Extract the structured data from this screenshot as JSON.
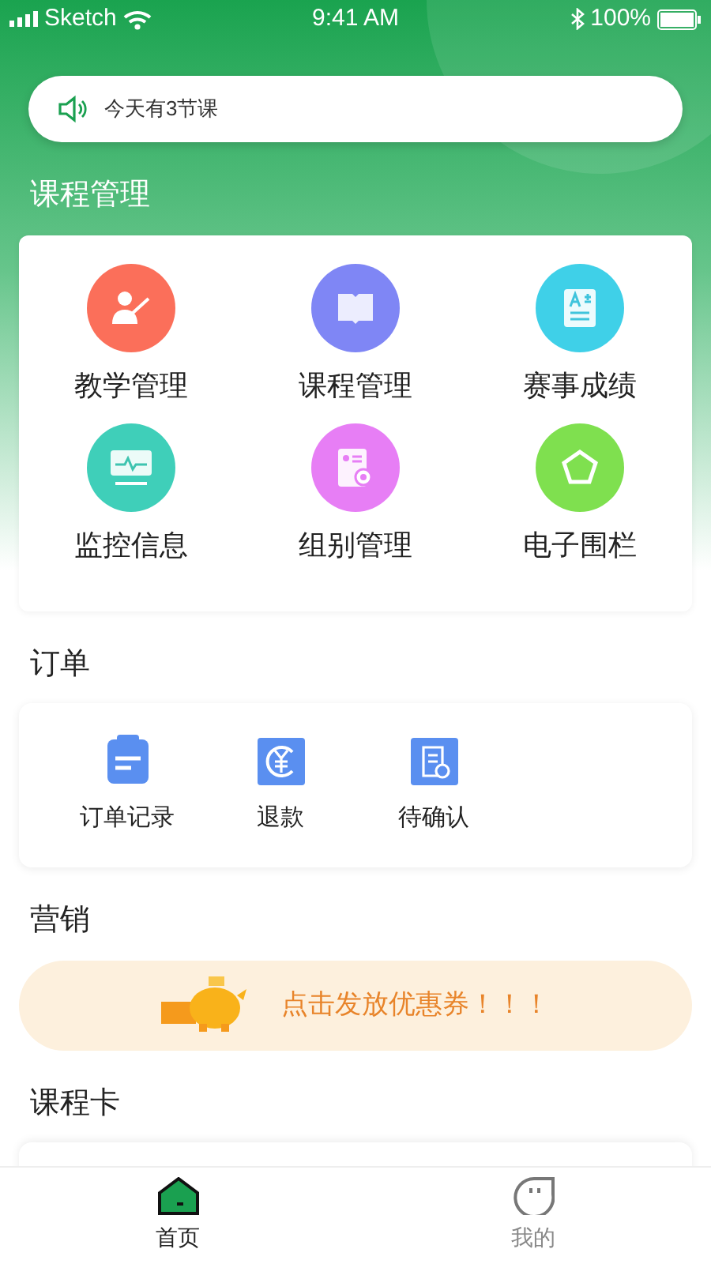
{
  "status_bar": {
    "carrier": "Sketch",
    "time": "9:41 AM",
    "battery": "100%"
  },
  "notice": {
    "text": "今天有3节课"
  },
  "course_section": {
    "title": "课程管理",
    "tiles": [
      {
        "label": "教学管理",
        "kind": "teacher",
        "color": "#fb6f5a"
      },
      {
        "label": "课程管理",
        "kind": "book",
        "color": "#7f86f5"
      },
      {
        "label": "赛事成绩",
        "kind": "grade",
        "color": "#3fd0e8"
      },
      {
        "label": "监控信息",
        "kind": "monitor",
        "color": "#3fcfb9"
      },
      {
        "label": "组别管理",
        "kind": "group",
        "color": "#e77ef5"
      },
      {
        "label": "电子围栏",
        "kind": "fence",
        "color": "#7fe04f"
      }
    ]
  },
  "order_section": {
    "title": "订单",
    "items": [
      {
        "label": "订单记录",
        "kind": "clipboard"
      },
      {
        "label": "退款",
        "kind": "refund"
      },
      {
        "label": "待确认",
        "kind": "pending"
      }
    ]
  },
  "marketing_section": {
    "title": "营销",
    "banner": "点击发放优惠券！！！"
  },
  "card_section": {
    "title": "课程卡"
  },
  "tab_bar": [
    {
      "label": "首页",
      "kind": "home",
      "selected": true
    },
    {
      "label": "我的",
      "kind": "me",
      "selected": false
    }
  ]
}
